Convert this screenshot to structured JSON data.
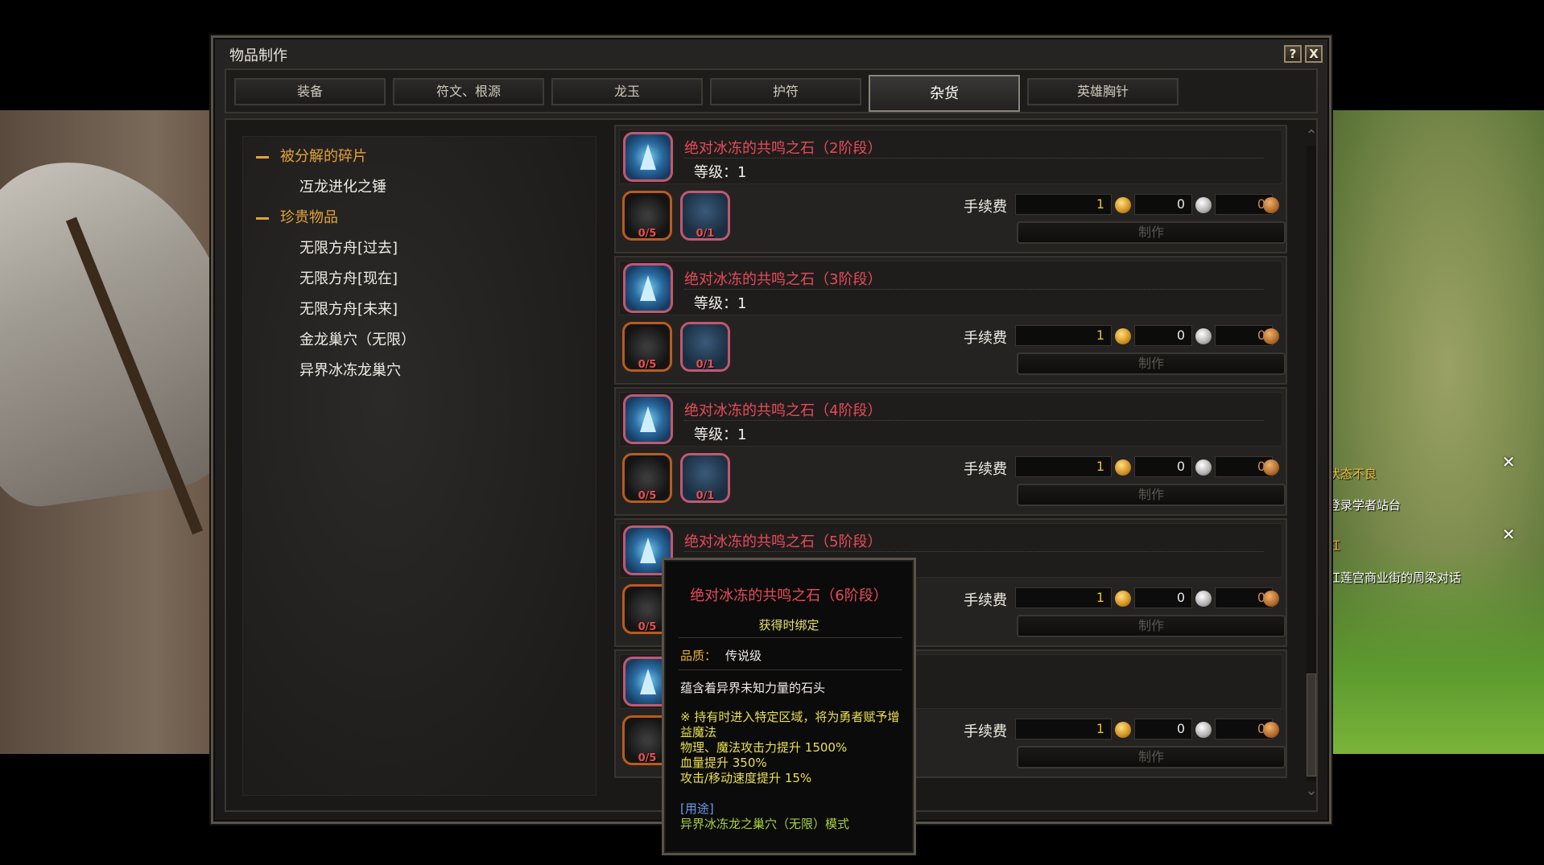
{
  "window": {
    "title": "物品制作",
    "help_label": "?",
    "close_label": "X"
  },
  "tabs": [
    {
      "label": "装备"
    },
    {
      "label": "符文、根源"
    },
    {
      "label": "龙玉"
    },
    {
      "label": "护符"
    },
    {
      "label": "杂货",
      "active": true
    },
    {
      "label": "英雄胸针"
    }
  ],
  "tree": {
    "categories": [
      {
        "label": "被分解的碎片",
        "items": [
          "冱龙进化之锤"
        ]
      },
      {
        "label": "珍贵物品",
        "items": [
          "无限方舟[过去]",
          "无限方舟[现在]",
          "无限方舟[未来]",
          "金龙巢穴（无限）",
          "异界冰冻龙巢穴"
        ]
      }
    ]
  },
  "recipes": [
    {
      "name": "绝对冰冻的共鸣之石（2阶段）",
      "level": "等级：1",
      "mat1_count": "0/5",
      "mat2_count": "0/1",
      "fee_label": "手续费",
      "gold": "1",
      "silver": "0",
      "bronze": "0",
      "make_label": "制作"
    },
    {
      "name": "绝对冰冻的共鸣之石（3阶段）",
      "level": "等级：1",
      "mat1_count": "0/5",
      "mat2_count": "0/1",
      "fee_label": "手续费",
      "gold": "1",
      "silver": "0",
      "bronze": "0",
      "make_label": "制作"
    },
    {
      "name": "绝对冰冻的共鸣之石（4阶段）",
      "level": "等级：1",
      "mat1_count": "0/5",
      "mat2_count": "0/1",
      "fee_label": "手续费",
      "gold": "1",
      "silver": "0",
      "bronze": "0",
      "make_label": "制作"
    },
    {
      "name": "绝对冰冻的共鸣之石（5阶段）",
      "level": "",
      "mat1_count": "0/5",
      "mat2_count": "",
      "fee_label": "手续费",
      "gold": "1",
      "silver": "0",
      "bronze": "0",
      "make_label": "制作"
    },
    {
      "name": "",
      "level": "",
      "mat1_count": "0/5",
      "mat2_count": "",
      "fee_label": "手续费",
      "gold": "1",
      "silver": "0",
      "bronze": "0",
      "make_label": "制作"
    }
  ],
  "tooltip": {
    "name": "绝对冰冻的共鸣之石（6阶段）",
    "bind": "获得时绑定",
    "quality_label": "品质：",
    "quality_value": "传说级",
    "description": "蕴含着异界未知力量的石头",
    "effects": [
      "※ 持有时进入特定区域，将为勇者赋予增益魔法",
      "物理、魔法攻击力提升 1500%",
      "血量提升 350%",
      "攻击/移动速度提升 15%"
    ],
    "use_label": "[用途]",
    "use_mode": "异界冰冻龙之巢穴（无限）模式"
  },
  "quests": [
    {
      "text": "状态不良"
    },
    {
      "text": "登录学者站台"
    },
    {
      "text": "红"
    },
    {
      "text": "红莲宫商业街的周梁对话"
    }
  ],
  "colors": {
    "item_name": "#e84a5a",
    "category": "#e3a338",
    "bind_text": "#e8e070",
    "use_mode": "#a8d040"
  },
  "icons": {
    "recipe_icon": "ice-castle-icon",
    "material_1": "dark-shard-icon",
    "material_2": "ice-castle-material-icon",
    "gold": "gold-coin-icon",
    "silver": "silver-coin-icon",
    "bronze": "bronze-coin-icon"
  }
}
